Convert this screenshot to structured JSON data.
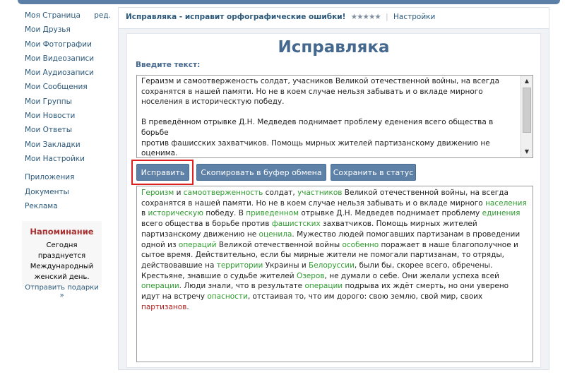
{
  "sidebar": {
    "items": [
      {
        "label": "Моя Страница"
      },
      {
        "label": "Мои Друзья"
      },
      {
        "label": "Мои Фотографии"
      },
      {
        "label": "Мои Видеозаписи"
      },
      {
        "label": "Мои Аудиозаписи"
      },
      {
        "label": "Мои Сообщения"
      },
      {
        "label": "Мои Группы"
      },
      {
        "label": "Мои Новости"
      },
      {
        "label": "Мои Ответы"
      },
      {
        "label": "Мои Закладки"
      },
      {
        "label": "Мои Настройки"
      }
    ],
    "edit_label": "ред.",
    "extra_items": [
      {
        "label": "Приложения"
      },
      {
        "label": "Документы"
      },
      {
        "label": "Реклама"
      }
    ]
  },
  "reminder": {
    "title": "Напоминание",
    "line1": "Сегодня празднуется",
    "line2": "Международный",
    "line3": "женский день.",
    "link": "Отправить подарки »"
  },
  "app": {
    "title": "Исправляка - исправит орфографические ошибки!",
    "rating_stars": "★★★★★",
    "settings_label": "Настройки",
    "heading": "Исправляка",
    "input_label": "Введите текст:",
    "input_text": "Гераизм и самоотверженость солдат, учасников Великой отечественной войны, на всегда\nсохранятся в нашей памяти. Но не в коем случае нельзя забывать и о вкладе мирного\nноселения в историческтую победу.\n\nВ преведённом отрывке Д.Н. Медведев поднимает проблему еденения всего общества в борьбе\nпротив фашисских захватчиков. Помощь мирных жителей партизанскому движению не оценима.\nМужество людей помогавших партизанам в проведении одной из опираций Великой\nотечественной войны  особено поражает в наше благополучное и сытое время. Действительно,",
    "buttons": {
      "fix": "Исправить",
      "copy": "Скопировать в буфер обмена",
      "save_status": "Сохранить в статус"
    },
    "output": {
      "w1": "Героизм",
      "t1": " и ",
      "w2": "самоотверженность",
      "t2": " солдат, ",
      "w3": "участников",
      "t3": " Великой отечественной войны, на всегда сохранятся в нашей памяти. Но не в коем случае нельзя забывать и о вкладе мирного ",
      "w4": "населения",
      "t4": " в ",
      "w5": "историческую",
      "t5": " победу. В ",
      "w6": "приведенном",
      "t6": " отрывке Д.Н. Медведев поднимает проблему ",
      "w7": "единения",
      "t7": " всего общества в борьбе против ",
      "w8": "фашистских",
      "t8": " захватчиков. Помощь мирных жителей партизанскому движению не ",
      "w9": "оценила",
      "t9": ". Мужество людей помогавших партизанам в проведении одной из ",
      "w10": "операций",
      "t10": " Великой отечественной войны ",
      "w11": "особенно",
      "t11": " поражает в наше благополучное и сытое время. Действительно, если бы мирные жители не помогали партизанам, то отряды, действовавшие на ",
      "w12": "территории",
      "t12": " Украины и ",
      "w13": "Белоруссии",
      "t13": ", были бы, скорее всего, обречены. Крестьяне, знавшие о судьбе жителей ",
      "w14": "Озеров",
      "t14": ", не думали о себе. Они желали успеха всей ",
      "w15": "операции",
      "t15": ". Люди знали, что в результате ",
      "w16": "операции",
      "t16": " подрыва их ждёт смерть, но они уверено идут на встречу ",
      "w17": "опасности",
      "t17": ", отстаивая то, что им дорого: свою землю, свой мир, своих ",
      "w18": "партизанов",
      "t18": "."
    }
  }
}
